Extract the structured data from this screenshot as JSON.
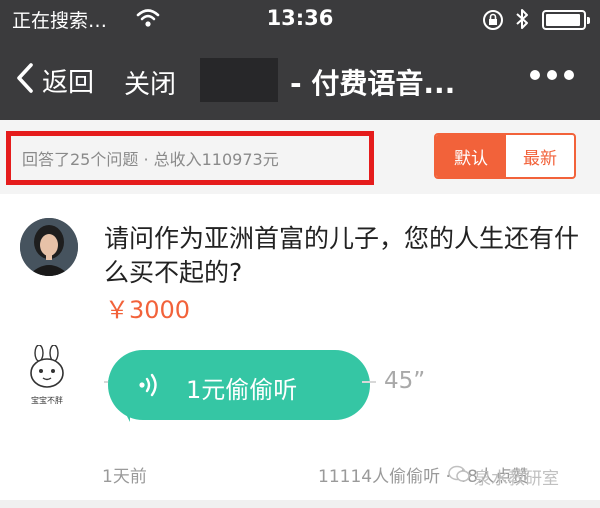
{
  "status_bar": {
    "carrier": "正在搜索…",
    "time": "13:36"
  },
  "nav": {
    "back_label": "返回",
    "close_label": "关闭",
    "title": "- 付费语音..."
  },
  "summary": {
    "text": "回答了25个问题 · 总收入110973元",
    "sort_default": "默认",
    "sort_latest": "最新",
    "accent_color": "#f2623a",
    "highlight_color": "#e51c1c"
  },
  "question": {
    "text": "请问作为亚洲首富的儿子，您的人生还有什么买不起的?",
    "price": "￥3000"
  },
  "answer": {
    "listen_label": "1元偷偷听",
    "duration": "45”",
    "bubble_color": "#35c6a4",
    "avatar_caption": "宝宝不胖"
  },
  "meta": {
    "time_ago": "1天前",
    "listeners": "11114人偷偷听 · 48人点赞",
    "watermark": "泉水教研室"
  },
  "icons": [
    "back-icon",
    "wifi-icon",
    "lock-rotation-icon",
    "bluetooth-icon",
    "battery-icon",
    "more-icon",
    "sound-wave-icon",
    "wechat-icon"
  ]
}
